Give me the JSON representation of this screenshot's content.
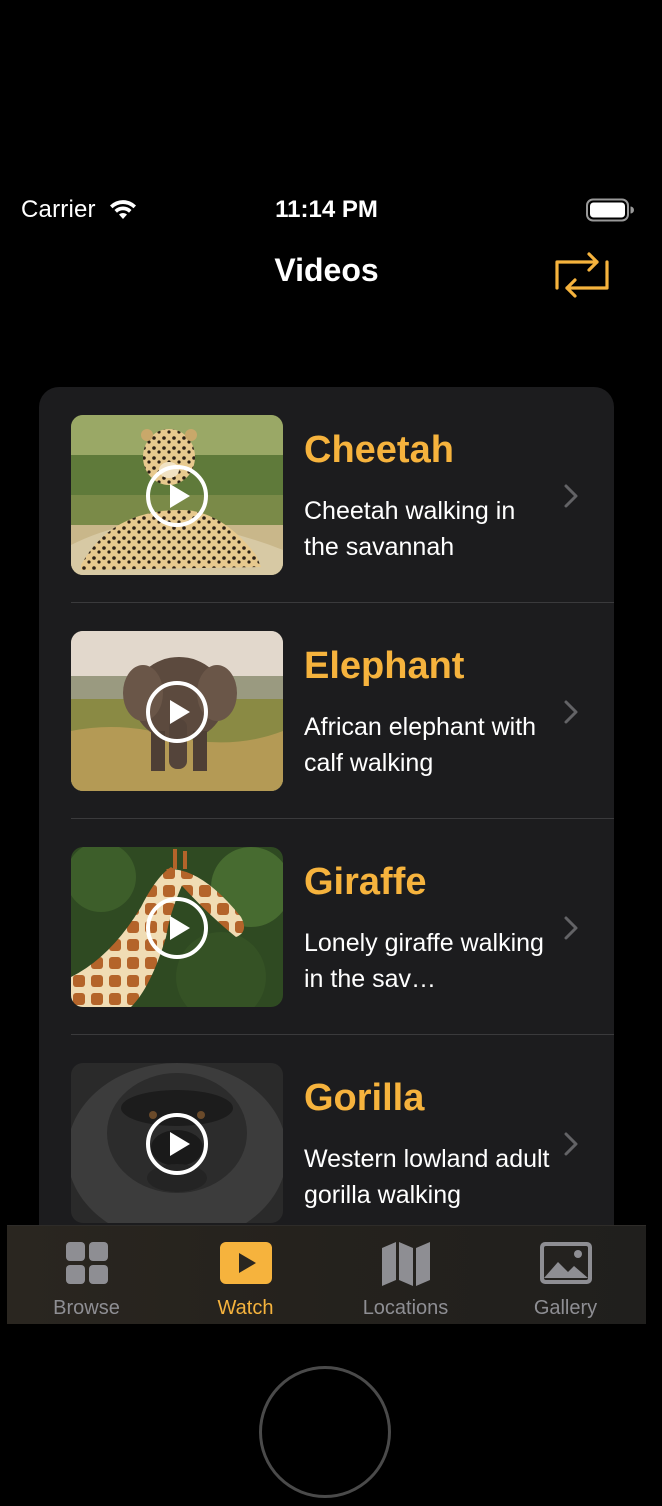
{
  "status_bar": {
    "carrier": "Carrier",
    "time": "11:14 PM",
    "icons": [
      "wifi-icon",
      "battery-icon"
    ]
  },
  "nav": {
    "title": "Videos",
    "swap_icon": "arrows-swap-icon"
  },
  "videos": [
    {
      "title": "Cheetah",
      "description": "Cheetah walking in the savannah"
    },
    {
      "title": "Elephant",
      "description": "African elephant with calf walking"
    },
    {
      "title": "Giraffe",
      "description": "Lonely giraffe walking in the sav…"
    },
    {
      "title": "Gorilla",
      "description": "Western lowland adult gorilla walking"
    }
  ],
  "tabs": [
    {
      "label": "Browse",
      "icon": "grid-icon",
      "active": false
    },
    {
      "label": "Watch",
      "icon": "play-rectangle-icon",
      "active": true
    },
    {
      "label": "Locations",
      "icon": "map-icon",
      "active": false
    },
    {
      "label": "Gallery",
      "icon": "photo-icon",
      "active": false
    }
  ],
  "colors": {
    "accent": "#f6b33d",
    "background": "#000000",
    "card": "#1c1c1e",
    "tab_inactive": "#8e8e93"
  }
}
